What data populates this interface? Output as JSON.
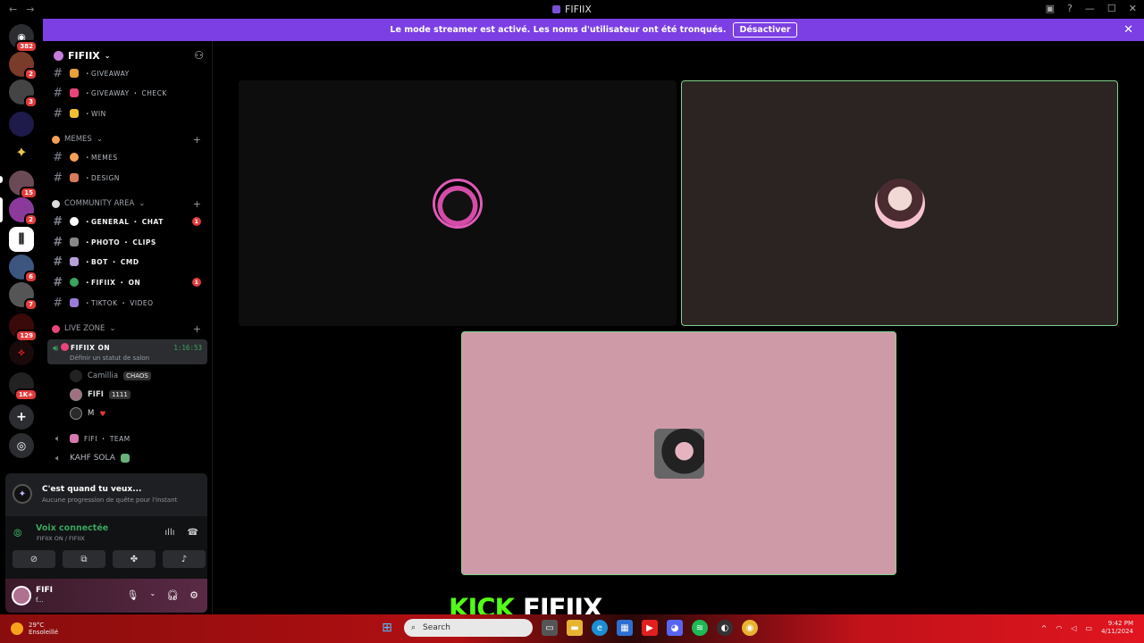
{
  "window": {
    "title": "FIFIIX",
    "back": "←",
    "forward": "→"
  },
  "banner": {
    "text": "Le mode streamer est activé. Les noms d'utilisateur ont été tronqués.",
    "button": "Désactiver"
  },
  "servers": {
    "badges": [
      "382",
      "2",
      "3",
      "15",
      "2",
      "6",
      "7",
      "129",
      "1K+"
    ]
  },
  "guild": {
    "name": "FIFIIX"
  },
  "channels": {
    "giveaway": "・GIVEAWAY",
    "giveaway_check": "・GIVEAWAY ・ CHECK",
    "win": "・WIN",
    "memes_cat": "MEMES",
    "memes": "・MEMES",
    "design": "・DESIGN",
    "community_cat": "COMMUNITY AREA",
    "general": "・GENERAL ・ CHAT",
    "general_unread": "1",
    "photo": "・PHOTO ・ CLIPS",
    "bot": "・BOT ・ CMD",
    "fifiix_on": "・FIFIIX ・ ON",
    "fifiix_on_unread": "1",
    "tiktok": "・TIKTOK ・ VIDEO",
    "live_cat": "LIVE ZONE",
    "live_name": "FIFIIX ON",
    "live_timer": "1:16:53",
    "live_status": "Définir un statut de salon",
    "team": "FIFI ・ TEAM",
    "kahf": "KAHF SOLA"
  },
  "voice_users": [
    {
      "name": "Camillia",
      "tag": "CHAOS"
    },
    {
      "name": "FIFI",
      "tag": "1111"
    },
    {
      "name": "M",
      "tag": ""
    }
  ],
  "quest": {
    "title": "C'est quand tu veux...",
    "subtitle": "Aucune progression de quête pour l'instant"
  },
  "voice": {
    "title": "Voix connectée",
    "subtitle": "FIFIIX ON / FIFIIX"
  },
  "user": {
    "name": "FIFI",
    "status": "f..."
  },
  "overlay": {
    "kick": "KICK",
    "name": "FIFIIX"
  },
  "taskbar": {
    "weather_temp": "29°C",
    "weather_desc": "Ensoleillé",
    "search": "Search",
    "time": "9:42 PM",
    "date": "4/11/2024"
  },
  "colors": {
    "accent": "#7b3fe4",
    "speaking": "#3ba55d",
    "kick_green": "#53fc18",
    "unread": "#e03b3b"
  }
}
